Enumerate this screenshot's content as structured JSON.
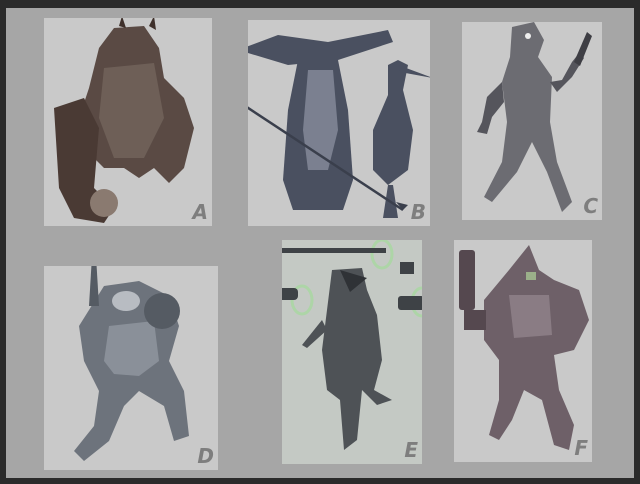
{
  "sheet": {
    "background": "#a6a6a6",
    "panels": [
      {
        "id": "A",
        "label": "A"
      },
      {
        "id": "B",
        "label": "B"
      },
      {
        "id": "C",
        "label": "C"
      },
      {
        "id": "D",
        "label": "D"
      },
      {
        "id": "E",
        "label": "E"
      },
      {
        "id": "F",
        "label": "F"
      }
    ]
  }
}
